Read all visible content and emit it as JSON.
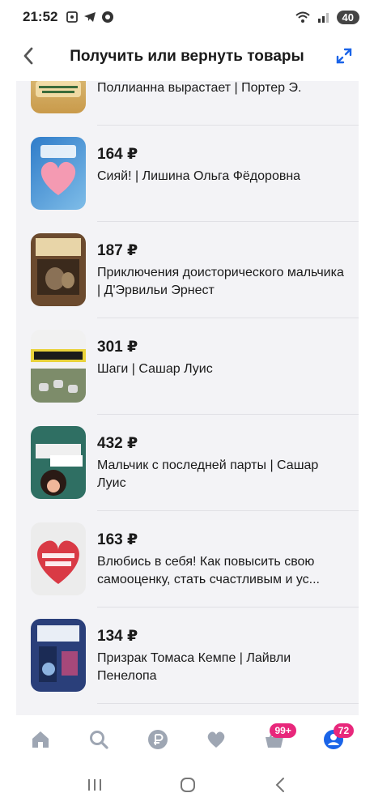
{
  "status": {
    "time": "21:52",
    "battery": "40"
  },
  "header": {
    "title": "Получить или вернуть товары"
  },
  "items": [
    {
      "price": "",
      "title": "Поллианна вырастает | Портер Э.",
      "cover": "#d7b56f"
    },
    {
      "price": "164 ₽",
      "title": "Сияй! | Лишина Ольга Фёдоровна",
      "cover": "#2f7cc9"
    },
    {
      "price": "187 ₽",
      "title": "Приключения доисторического мальчика | Д'Эрвильи Эрнест",
      "cover": "#6b4a2e"
    },
    {
      "price": "301 ₽",
      "title": "Шаги | Сашар Луис",
      "cover": "#e9d23a"
    },
    {
      "price": "432 ₽",
      "title": "Мальчик с последней парты | Сашар Луис",
      "cover": "#2f6f63"
    },
    {
      "price": "163 ₽",
      "title": "Влюбись в себя! Как повысить свою самооценку, стать счастливым и ус...",
      "cover": "#d93a45"
    },
    {
      "price": "134 ₽",
      "title": "Призрак Томаса Кемпе | Лайвли Пенелопа",
      "cover": "#2a3f7a"
    }
  ],
  "nav": {
    "cart_badge": "99+",
    "profile_badge": "72",
    "active_color": "#1a64e8",
    "icon_color": "#9ea6b3"
  }
}
